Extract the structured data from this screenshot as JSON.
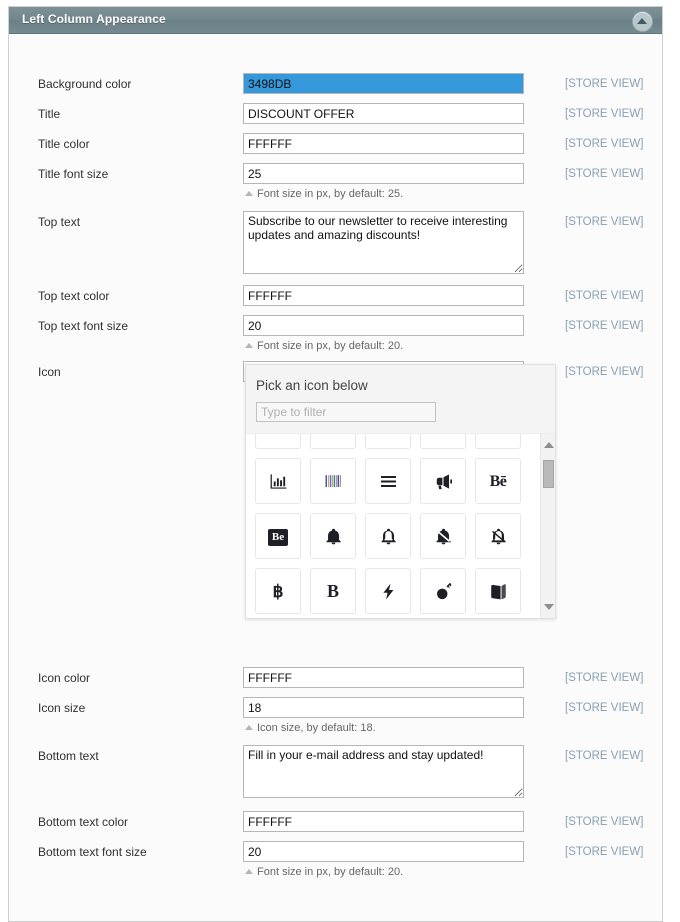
{
  "panel": {
    "title": "Left Column Appearance",
    "collapse_icon": "triangle-up-icon",
    "scope_label": "[STORE VIEW]"
  },
  "fields": [
    {
      "label": "Background color",
      "type": "text",
      "value": "3498DB",
      "scope": "[STORE VIEW]",
      "swatch": "#3498DB",
      "hint": ""
    },
    {
      "label": "Title",
      "type": "text",
      "value": "DISCOUNT OFFER",
      "scope": "[STORE VIEW]",
      "hint": ""
    },
    {
      "label": "Title color",
      "type": "text",
      "value": "FFFFFF",
      "scope": "[STORE VIEW]",
      "hint": ""
    },
    {
      "label": "Title font size",
      "type": "text",
      "value": "25",
      "scope": "[STORE VIEW]",
      "hint": "Font size in px, by default: 25."
    },
    {
      "label": "Top text",
      "type": "textarea",
      "value": "Subscribe to our newsletter to receive interesting updates and amazing discounts!",
      "scope": "[STORE VIEW]",
      "hint": ""
    },
    {
      "label": "Top text color",
      "type": "text",
      "value": "FFFFFF",
      "scope": "[STORE VIEW]",
      "hint": ""
    },
    {
      "label": "Top text font size",
      "type": "text",
      "value": "20",
      "scope": "[STORE VIEW]",
      "hint": "Font size in px, by default: 20."
    },
    {
      "label": "Icon",
      "type": "text",
      "value": "fa-thumbs-up",
      "scope": "[STORE VIEW]",
      "hint": ""
    },
    {
      "label": "Icon color",
      "type": "text",
      "value": "FFFFFF",
      "scope": "[STORE VIEW]",
      "hint": ""
    },
    {
      "label": "Icon size",
      "type": "text",
      "value": "18",
      "scope": "[STORE VIEW]",
      "hint": "Icon size, by default: 18."
    },
    {
      "label": "Bottom text",
      "type": "textarea",
      "value": "Fill in your e-mail address and stay updated!",
      "scope": "[STORE VIEW]",
      "hint": ""
    },
    {
      "label": "Bottom text color",
      "type": "text",
      "value": "FFFFFF",
      "scope": "[STORE VIEW]",
      "hint": ""
    },
    {
      "label": "Bottom text font size",
      "type": "text",
      "value": "20",
      "scope": "[STORE VIEW]",
      "hint": "Font size in px, by default: 20."
    }
  ],
  "icon_picker": {
    "title": "Pick an icon below",
    "filter_placeholder": "Type to filter",
    "filter_value": "",
    "scroll_up_icon": "triangle-up-icon",
    "scroll_down_icon": "triangle-down-icon",
    "rows": [
      {
        "partial": true,
        "icons": [
          "fa-balance-scale",
          "fa-ban",
          "fa-bandcamp",
          "fa-bank",
          "fa-bar-chart"
        ]
      },
      {
        "partial": false,
        "icons": [
          "fa-bar-chart-o",
          "fa-barcode",
          "fa-bars",
          "fa-bullhorn",
          "fa-behance"
        ]
      },
      {
        "partial": false,
        "icons": [
          "fa-behance-square",
          "fa-bell",
          "fa-bell-o",
          "fa-bell-slash",
          "fa-bell-slash-o"
        ]
      },
      {
        "partial": false,
        "icons": [
          "fa-bitcoin",
          "fa-bold",
          "fa-bolt",
          "fa-bomb",
          "fa-book"
        ]
      }
    ]
  }
}
